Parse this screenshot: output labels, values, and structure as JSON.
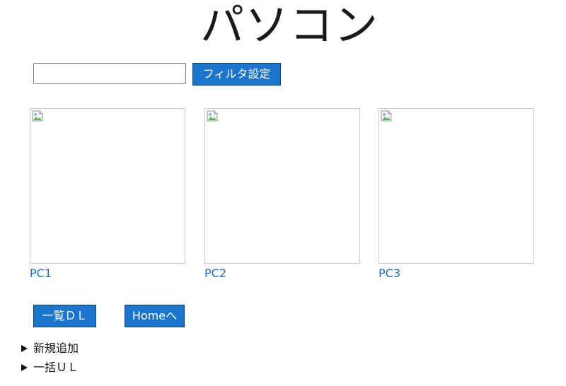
{
  "page": {
    "title": "パソコン"
  },
  "filter": {
    "input_value": "",
    "button_label": "フィルタ設定"
  },
  "items": [
    {
      "label": "PC1"
    },
    {
      "label": "PC2"
    },
    {
      "label": "PC3"
    }
  ],
  "actions": {
    "download_label": "一覧ＤＬ",
    "home_label": "Homeへ"
  },
  "sections": [
    {
      "label": "新規追加"
    },
    {
      "label": "一括ＵＬ"
    }
  ],
  "colors": {
    "button_bg": "#1a75cf",
    "link": "#1a6fc9"
  }
}
